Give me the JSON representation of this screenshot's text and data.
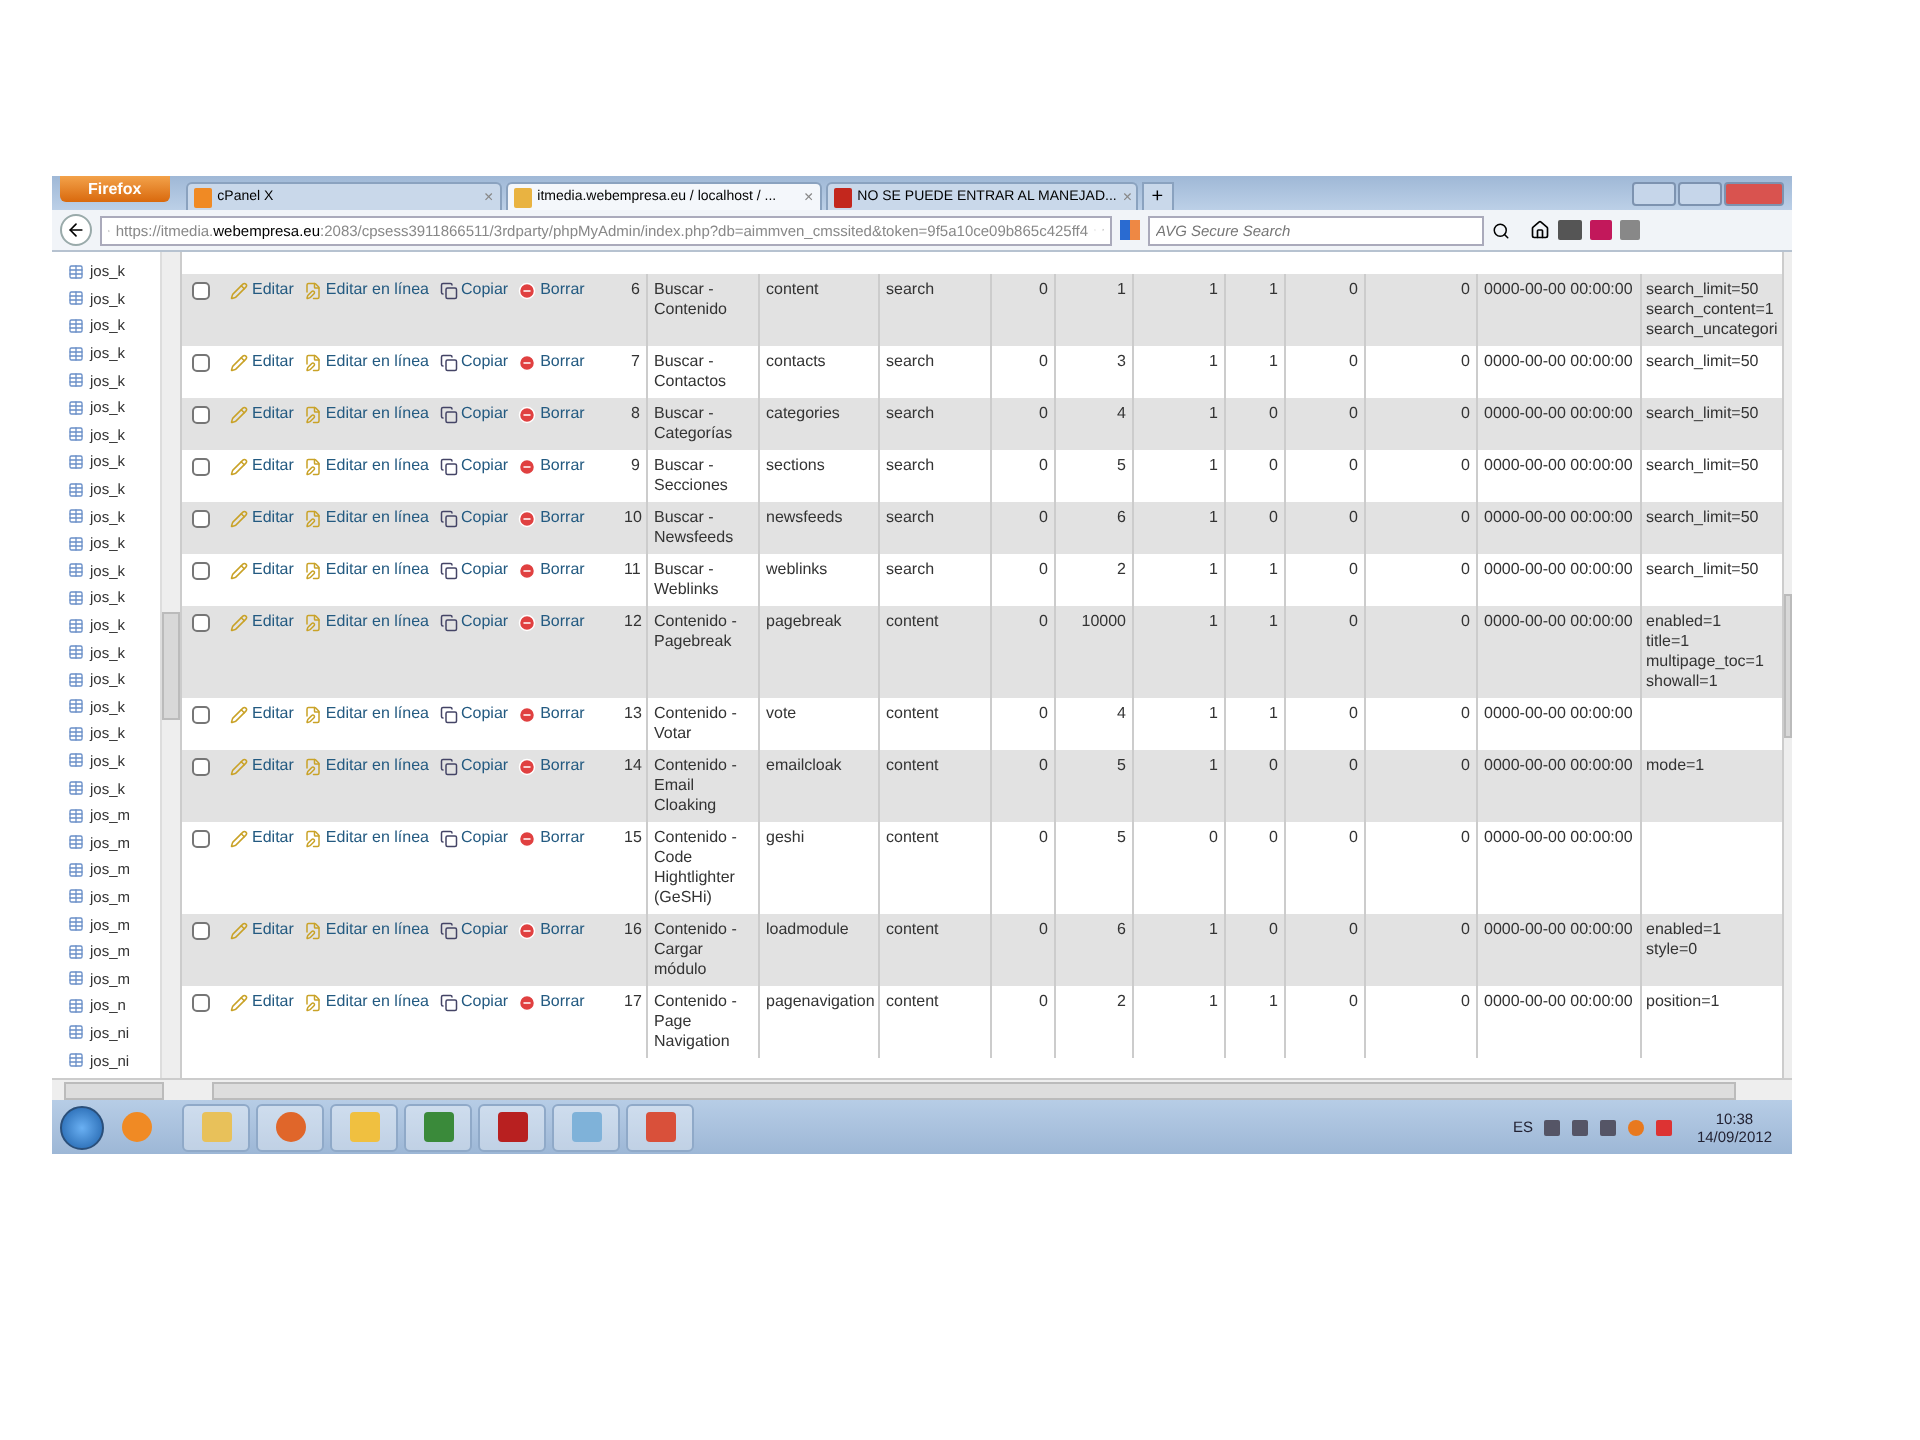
{
  "browser": {
    "menu_button": "Firefox",
    "tabs": [
      {
        "label": "cPanel X",
        "selected": false,
        "close": "×"
      },
      {
        "label": "itmedia.webempresa.eu / localhost / ...",
        "selected": true,
        "close": "×"
      },
      {
        "label": "NO SE PUEDE ENTRAR AL MANEJAD...",
        "selected": false,
        "close": "×"
      }
    ],
    "new_tab": "+",
    "url": "https://itmedia.**webempresa.eu**:2083/cpsess3911866511/3rdparty/phpMyAdmin/index.php?db=aimmven_cmssited&token=9f5a10ce09b865c425ff4",
    "search": {
      "placeholder": "AVG Secure Search"
    }
  },
  "sidebar": {
    "items": [
      "jos_k",
      "jos_k",
      "jos_k",
      "jos_k",
      "jos_k",
      "jos_k",
      "jos_k",
      "jos_k",
      "jos_k",
      "jos_k",
      "jos_k",
      "jos_k",
      "jos_k",
      "jos_k",
      "jos_k",
      "jos_k",
      "jos_k",
      "jos_k",
      "jos_k",
      "jos_k",
      "jos_m",
      "jos_m",
      "jos_m",
      "jos_m",
      "jos_m",
      "jos_m",
      "jos_m",
      "jos_n",
      "jos_ni",
      "jos_ni"
    ]
  },
  "table": {
    "rows": [
      {
        "checked": false,
        "actions": [
          "Editar",
          "Editar en línea",
          "Copiar",
          "Borrar"
        ],
        "cells": [
          "6",
          "Buscar - Contenido",
          "content",
          "search",
          "0",
          "1",
          "1",
          "1",
          "0",
          "0",
          "0000-00-00 00:00:00"
        ],
        "params": [
          "search_limit=50",
          "search_content=1",
          "search_uncategori"
        ]
      },
      {
        "checked": false,
        "actions": [
          "Editar",
          "Editar en línea",
          "Copiar",
          "Borrar"
        ],
        "cells": [
          "7",
          "Buscar - Contactos",
          "contacts",
          "search",
          "0",
          "3",
          "1",
          "1",
          "0",
          "0",
          "0000-00-00 00:00:00"
        ],
        "params": [
          "search_limit=50"
        ]
      },
      {
        "checked": false,
        "actions": [
          "Editar",
          "Editar en línea",
          "Copiar",
          "Borrar"
        ],
        "cells": [
          "8",
          "Buscar - Categorías",
          "categories",
          "search",
          "0",
          "4",
          "1",
          "0",
          "0",
          "0",
          "0000-00-00 00:00:00"
        ],
        "params": [
          "search_limit=50"
        ]
      },
      {
        "checked": false,
        "actions": [
          "Editar",
          "Editar en línea",
          "Copiar",
          "Borrar"
        ],
        "cells": [
          "9",
          "Buscar - Secciones",
          "sections",
          "search",
          "0",
          "5",
          "1",
          "0",
          "0",
          "0",
          "0000-00-00 00:00:00"
        ],
        "params": [
          "search_limit=50"
        ]
      },
      {
        "checked": false,
        "actions": [
          "Editar",
          "Editar en línea",
          "Copiar",
          "Borrar"
        ],
        "cells": [
          "10",
          "Buscar - Newsfeeds",
          "newsfeeds",
          "search",
          "0",
          "6",
          "1",
          "0",
          "0",
          "0",
          "0000-00-00 00:00:00"
        ],
        "params": [
          "search_limit=50"
        ]
      },
      {
        "checked": false,
        "actions": [
          "Editar",
          "Editar en línea",
          "Copiar",
          "Borrar"
        ],
        "cells": [
          "11",
          "Buscar - Weblinks",
          "weblinks",
          "search",
          "0",
          "2",
          "1",
          "1",
          "0",
          "0",
          "0000-00-00 00:00:00"
        ],
        "params": [
          "search_limit=50"
        ]
      },
      {
        "checked": false,
        "actions": [
          "Editar",
          "Editar en línea",
          "Copiar",
          "Borrar"
        ],
        "cells": [
          "12",
          "Contenido - Pagebreak",
          "pagebreak",
          "content",
          "0",
          "10000",
          "1",
          "1",
          "0",
          "0",
          "0000-00-00 00:00:00"
        ],
        "params": [
          "enabled=1",
          "title=1",
          "multipage_toc=1",
          "showall=1"
        ]
      },
      {
        "checked": false,
        "actions": [
          "Editar",
          "Editar en línea",
          "Copiar",
          "Borrar"
        ],
        "cells": [
          "13",
          "Contenido - Votar",
          "vote",
          "content",
          "0",
          "4",
          "1",
          "1",
          "0",
          "0",
          "0000-00-00 00:00:00"
        ],
        "params": []
      },
      {
        "checked": false,
        "actions": [
          "Editar",
          "Editar en línea",
          "Copiar",
          "Borrar"
        ],
        "cells": [
          "14",
          "Contenido - Email Cloaking",
          "emailcloak",
          "content",
          "0",
          "5",
          "1",
          "0",
          "0",
          "0",
          "0000-00-00 00:00:00"
        ],
        "params": [
          "mode=1"
        ]
      },
      {
        "checked": false,
        "actions": [
          "Editar",
          "Editar en línea",
          "Copiar",
          "Borrar"
        ],
        "cells": [
          "15",
          "Contenido - Code Hightlighter (GeSHi)",
          "geshi",
          "content",
          "0",
          "5",
          "0",
          "0",
          "0",
          "0",
          "0000-00-00 00:00:00"
        ],
        "params": []
      },
      {
        "checked": false,
        "actions": [
          "Editar",
          "Editar en línea",
          "Copiar",
          "Borrar"
        ],
        "cells": [
          "16",
          "Contenido - Cargar módulo",
          "loadmodule",
          "content",
          "0",
          "6",
          "1",
          "0",
          "0",
          "0",
          "0000-00-00 00:00:00"
        ],
        "params": [
          "enabled=1",
          "style=0"
        ]
      },
      {
        "checked": false,
        "actions": [
          "Editar",
          "Editar en línea",
          "Copiar",
          "Borrar"
        ],
        "cells": [
          "17",
          "Contenido - Page Navigation",
          "pagenavigation",
          "content",
          "0",
          "2",
          "1",
          "1",
          "0",
          "0",
          "0000-00-00 00:00:00"
        ],
        "params": [
          "position=1"
        ]
      }
    ]
  },
  "taskbar": {
    "language": "ES",
    "time": "10:38",
    "date": "14/09/2012"
  }
}
